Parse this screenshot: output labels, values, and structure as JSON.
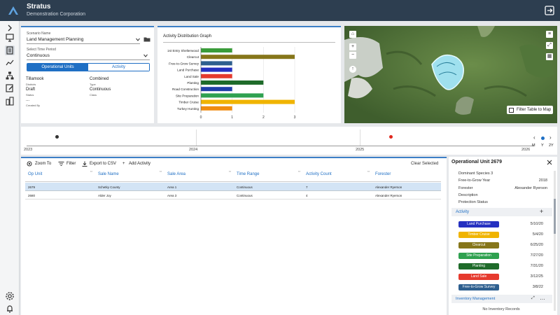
{
  "header": {
    "title": "Stratus",
    "subtitle": "Demonstration Corporation"
  },
  "scenario": {
    "name_label": "Scenario Name",
    "name_value": "Land Management Planning",
    "period_label": "Select Time Period",
    "period_value": "Continuous",
    "tabs": [
      {
        "label": "Operational Units"
      },
      {
        "label": "Activity"
      }
    ],
    "fields": [
      {
        "value": "Tillamook",
        "label": "Districts"
      },
      {
        "value": "Combined",
        "label": "Type"
      },
      {
        "value": "Draft",
        "label": "Status"
      },
      {
        "value": "Continuous",
        "label": "Class"
      },
      {
        "value": "...",
        "label": "Created By"
      }
    ]
  },
  "chart_data": {
    "type": "bar",
    "title": "Activity Distribution Graph",
    "categories": [
      "1st Entry Shelterwood",
      "Clearcut",
      "Free-to-Grow Survey",
      "Land Purchase",
      "Land Sale",
      "Planting",
      "Road Construction",
      "Site Preparation",
      "Timber Cruise",
      "Turkey Hunting"
    ],
    "values": [
      1,
      3,
      1,
      1,
      1,
      2,
      1,
      2,
      3,
      1
    ],
    "colors": [
      "#3a9c3a",
      "#86761a",
      "#2e5f8f",
      "#2530c0",
      "#e63a2e",
      "#1f6b2a",
      "#1f3fa8",
      "#2fa150",
      "#f0b400",
      "#f08c10"
    ],
    "xticks": [
      "0",
      "1",
      "2",
      "3"
    ],
    "xlim": [
      0,
      3
    ]
  },
  "map": {
    "filter_label": "Filter Table to Map"
  },
  "timeline": {
    "years": [
      "2023",
      "2024",
      "2025",
      "2026"
    ],
    "scales": [
      "M",
      "Y",
      "2Y"
    ]
  },
  "table": {
    "toolbar": {
      "zoom": "Zoom To",
      "filter": "Filter",
      "export": "Export to CSV",
      "add": "Add Activity",
      "clear": "Clear Selected"
    },
    "headers": [
      "Op Unit",
      "Sale Name",
      "Sale Area",
      "Time Range",
      "Activity Count",
      "Forester"
    ],
    "rows": [
      [
        "2679",
        "Schetky County",
        "Area 1",
        "Continuous",
        "7",
        "Alexander Ryerson"
      ],
      [
        "2680",
        "Alder Joy",
        "Area 3",
        "Continuous",
        "4",
        "Alexander Ryerson"
      ]
    ]
  },
  "side": {
    "title": "Operational Unit 2679",
    "props": [
      {
        "k": "Dominant Species 3",
        "v": ""
      },
      {
        "k": "Free-to-Grow Year",
        "v": "2018"
      },
      {
        "k": "Forester",
        "v": "Alexander Ryerson"
      },
      {
        "k": "Description",
        "v": ""
      },
      {
        "k": "Protection Status",
        "v": ""
      }
    ],
    "activity_header": "Activity",
    "activities": [
      {
        "name": "Land Purchase",
        "date": "5/10/20",
        "color": "#2530c0"
      },
      {
        "name": "Timber Cruise",
        "date": "5/4/20",
        "color": "#f0b400"
      },
      {
        "name": "Clearcut",
        "date": "6/25/20",
        "color": "#86761a"
      },
      {
        "name": "Site Preparation",
        "date": "7/27/20",
        "color": "#2fa150"
      },
      {
        "name": "Planting",
        "date": "7/31/20",
        "color": "#1f6b2a"
      },
      {
        "name": "Land Sale",
        "date": "3/12/25",
        "color": "#e63a2e"
      },
      {
        "name": "Free-to-Grow Survey",
        "date": "3/8/22",
        "color": "#2e5f8f"
      }
    ],
    "inventory_header": "Inventory Management",
    "inventory_empty": "No Inventory Records"
  }
}
